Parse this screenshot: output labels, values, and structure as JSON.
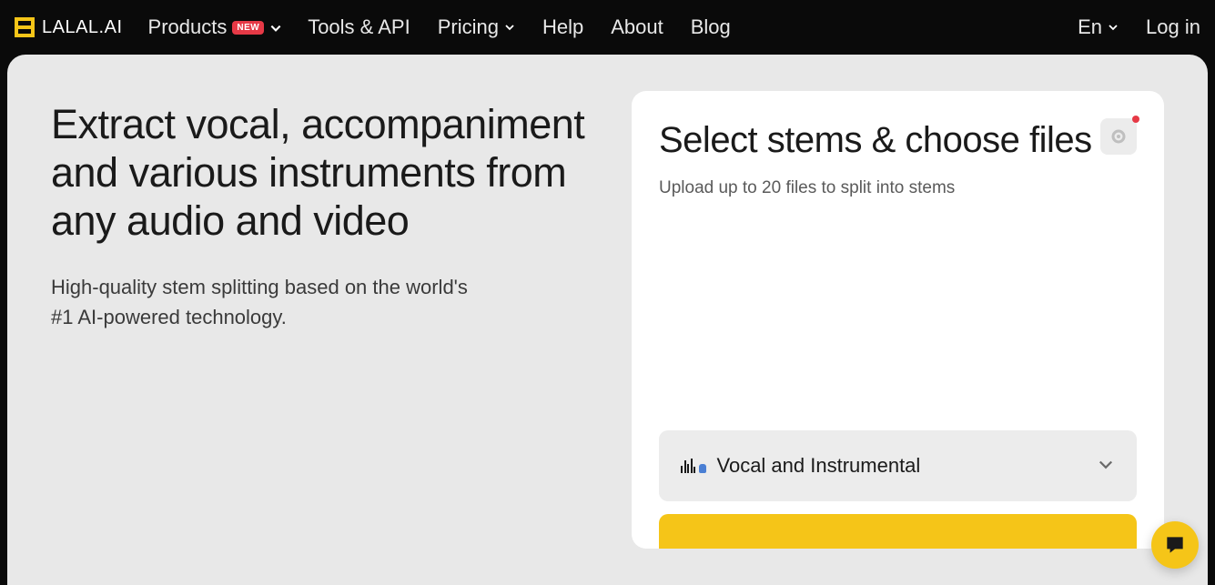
{
  "brand": "LALAL.AI",
  "nav": {
    "products": "Products",
    "products_badge": "NEW",
    "tools": "Tools & API",
    "pricing": "Pricing",
    "help": "Help",
    "about": "About",
    "blog": "Blog"
  },
  "topright": {
    "lang": "En",
    "login": "Log in"
  },
  "hero": {
    "title": "Extract vocal, accompaniment and various instruments from any audio and video",
    "subtitle": "High-quality stem splitting based on the world's #1 AI-powered technology."
  },
  "card": {
    "title": "Select stems & choose files",
    "subtitle": "Upload up to 20 files to split into stems",
    "dropdown_label": "Vocal and Instrumental"
  }
}
